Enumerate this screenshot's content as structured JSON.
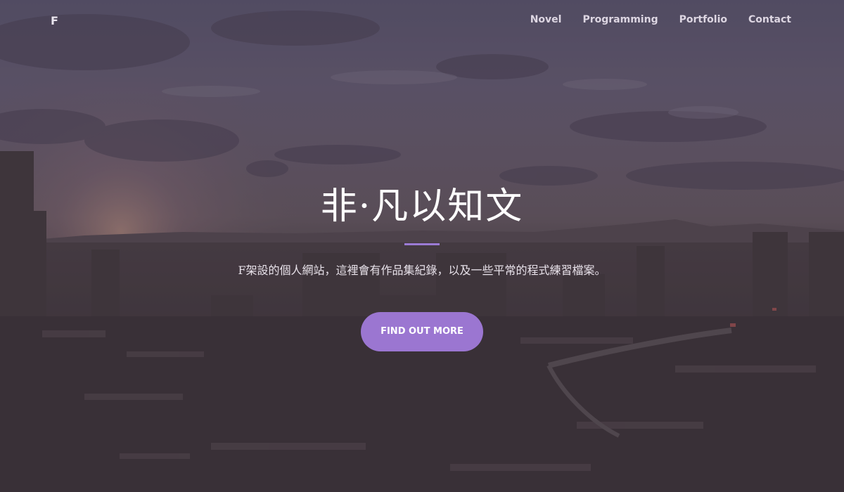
{
  "navbar": {
    "brand": "F",
    "links": [
      "Novel",
      "Programming",
      "Portfolio",
      "Contact"
    ]
  },
  "hero": {
    "title": "非·凡以知文",
    "subtitle": "F架設的個人網站，這裡會有作品集紀錄，以及一些平常的程式練習檔案。",
    "cta_label": "FIND OUT MORE"
  },
  "colors": {
    "accent": "#9b76d1",
    "divider": "#9b7bd4",
    "overlay": "#5f5a75"
  }
}
